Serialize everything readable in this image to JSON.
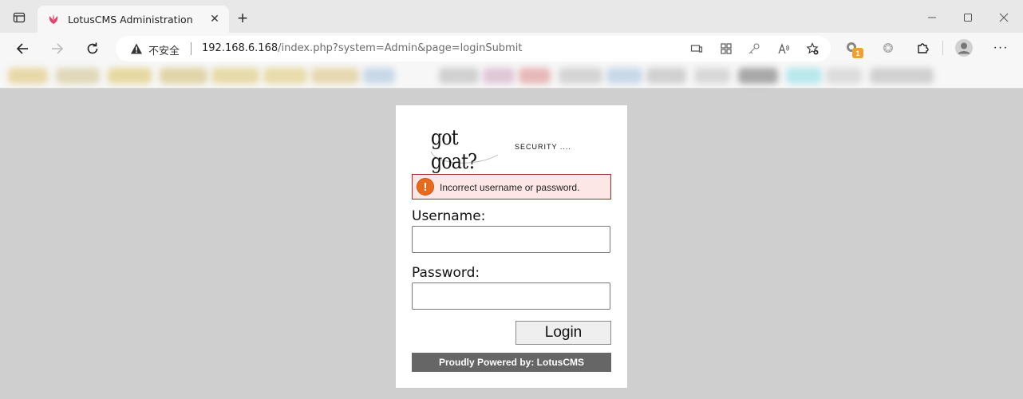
{
  "browser": {
    "tab": {
      "title": "LotusCMS Administration",
      "favicon": "lotus-icon"
    },
    "window_controls": [
      "minimize-icon",
      "maximize-icon",
      "close-icon"
    ],
    "address_bar": {
      "security_label": "不安全",
      "url_host": "192.168.6.168",
      "url_path": "/index.php?system=Admin&page=loginSubmit"
    },
    "extension_badge": "1",
    "colors": {
      "chrome_bg": "#e8e8e8",
      "toolbar_bg": "#f7f7f7"
    }
  },
  "page": {
    "background": "#cfcfcf",
    "logo_text": "got goat?",
    "tagline": "SECURITY ....",
    "error_message": "Incorrect username or password.",
    "username_label": "Username:",
    "username_value": "",
    "password_label": "Password:",
    "password_value": "",
    "login_button": "Login",
    "footer": "Proudly Powered by: LotusCMS",
    "colors": {
      "error_bg": "#fde6e6",
      "error_border": "#a52b2b",
      "footer_bg": "#666666"
    }
  }
}
